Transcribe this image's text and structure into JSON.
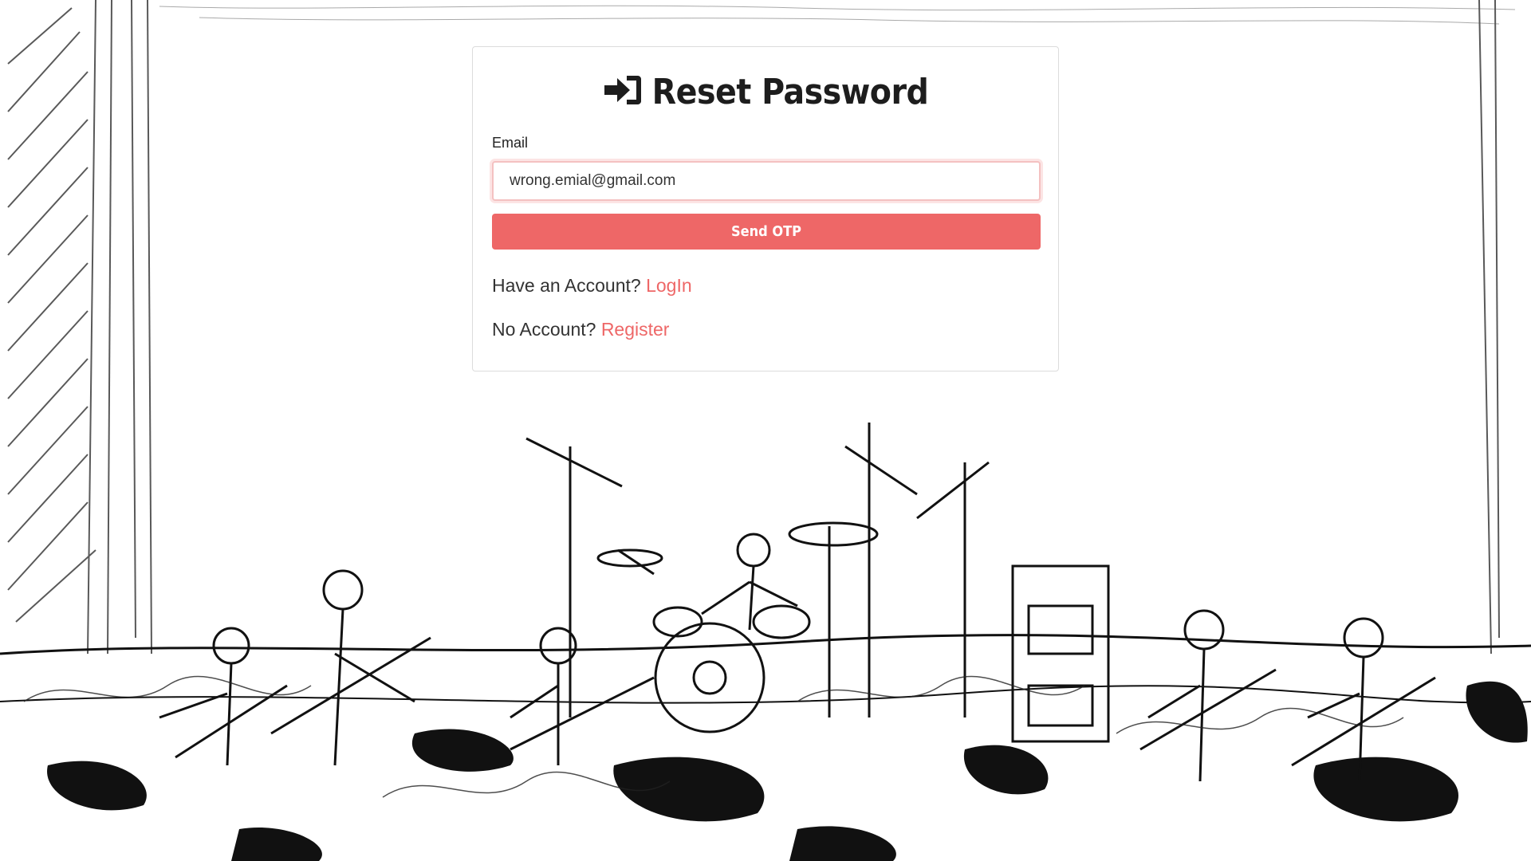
{
  "card": {
    "title": "Reset Password",
    "title_icon": "sign-in-icon",
    "email_label": "Email",
    "email_value": "wrong.emial@gmail.com",
    "send_button_label": "Send OTP",
    "have_account_text": "Have an Account?",
    "login_link": "LogIn",
    "no_account_text": "No Account?",
    "register_link": "Register"
  },
  "colors": {
    "accent": "#ee6767",
    "input_focus_border": "#f4c1c1",
    "card_border": "#dcdcdc"
  },
  "background": {
    "illustration": "ink-sketch-of-rock-band-on-stage"
  }
}
